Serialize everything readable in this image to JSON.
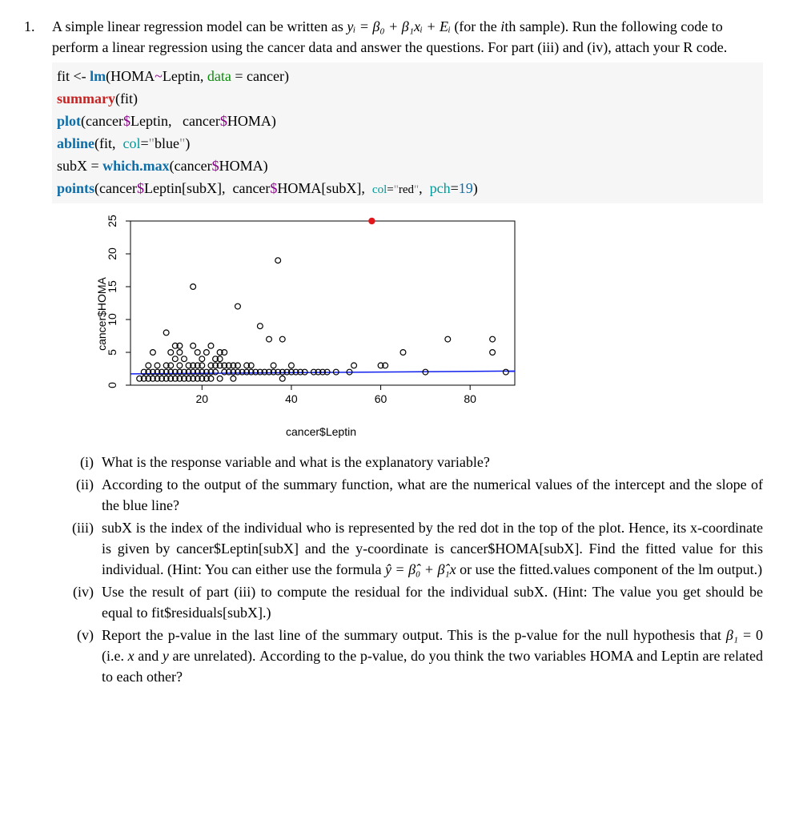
{
  "numLabel": "1.",
  "intro": "A simple linear regression model can be written as ",
  "equation": "yᵢ = β₀ + β₁xᵢ + Eᵢ",
  "introTail": " (for the ",
  "ith": "i",
  "introTail2": "th sample). Run the following code to perform a linear regression using the cancer data and answer the questions. For part (iii) and (iv), attach your R code.",
  "code": {
    "l1a": "fit <- ",
    "l1b": "lm",
    "l1c": "(HOMA",
    "l1d": "~",
    "l1e": "Leptin, ",
    "l1f": "data",
    "l1g": " = cancer)",
    "l2a": "summary",
    "l2b": "(fit)",
    "l3a": "plot",
    "l3b": "(cancer",
    "l3c": "$",
    "l3d": "Leptin,   cancer",
    "l3e": "$",
    "l3f": "HOMA)",
    "l4a": "abline",
    "l4b": "(fit,  ",
    "l4c": "col",
    "l4d": "=",
    "l4e": "\"",
    "l4f": "blue",
    "l4g": "\"",
    "l4h": ")",
    "l5a": "subX = ",
    "l5b": "which.max",
    "l5c": "(cancer",
    "l5d": "$",
    "l5e": "HOMA)",
    "l6a": "points",
    "l6b": "(cancer",
    "l6c": "$",
    "l6d": "Leptin[subX],  cancer",
    "l6e": "$",
    "l6f": "HOMA[subX],  ",
    "l6g": "col",
    "l6h": "=",
    "l6i": "\"",
    "l6j": "red",
    "l6k": "\"",
    "l6l": ",  ",
    "l6m": "pch",
    "l6n": "=",
    "l6o": "19",
    "l6p": ")"
  },
  "chart_data": {
    "type": "scatter",
    "xlabel": "cancer$Leptin",
    "ylabel": "cancer$HOMA",
    "xlim": [
      4,
      90
    ],
    "ylim": [
      0,
      25
    ],
    "xticks": [
      20,
      40,
      60,
      80
    ],
    "yticks": [
      0,
      5,
      10,
      15,
      20,
      25
    ],
    "abline": {
      "intercept": 1.7,
      "slope": 0.005,
      "color": "blue"
    },
    "highlight": {
      "x": 58,
      "y": 25,
      "color": "red"
    },
    "series": [
      {
        "name": "points",
        "marker": "open-circle",
        "data": [
          [
            6,
            1
          ],
          [
            7,
            2
          ],
          [
            7,
            1
          ],
          [
            8,
            1
          ],
          [
            8,
            2
          ],
          [
            8,
            3
          ],
          [
            9,
            1
          ],
          [
            9,
            2
          ],
          [
            9,
            5
          ],
          [
            10,
            2
          ],
          [
            10,
            1
          ],
          [
            10,
            3
          ],
          [
            11,
            1
          ],
          [
            11,
            2
          ],
          [
            12,
            1
          ],
          [
            12,
            2
          ],
          [
            12,
            3
          ],
          [
            12,
            8
          ],
          [
            13,
            1
          ],
          [
            13,
            2
          ],
          [
            13,
            3
          ],
          [
            13,
            5
          ],
          [
            14,
            1
          ],
          [
            14,
            2
          ],
          [
            14,
            4
          ],
          [
            14,
            6
          ],
          [
            15,
            1
          ],
          [
            15,
            2
          ],
          [
            15,
            3
          ],
          [
            15,
            5
          ],
          [
            15,
            6
          ],
          [
            16,
            1
          ],
          [
            16,
            2
          ],
          [
            16,
            4
          ],
          [
            17,
            1
          ],
          [
            17,
            2
          ],
          [
            17,
            3
          ],
          [
            18,
            1
          ],
          [
            18,
            2
          ],
          [
            18,
            3
          ],
          [
            18,
            6
          ],
          [
            18,
            15
          ],
          [
            19,
            1
          ],
          [
            19,
            2
          ],
          [
            19,
            3
          ],
          [
            19,
            5
          ],
          [
            20,
            1
          ],
          [
            20,
            2
          ],
          [
            20,
            3
          ],
          [
            20,
            4
          ],
          [
            21,
            1
          ],
          [
            21,
            2
          ],
          [
            21,
            5
          ],
          [
            22,
            1
          ],
          [
            22,
            2
          ],
          [
            22,
            3
          ],
          [
            22,
            6
          ],
          [
            23,
            2
          ],
          [
            23,
            3
          ],
          [
            23,
            4
          ],
          [
            24,
            1
          ],
          [
            24,
            3
          ],
          [
            24,
            4
          ],
          [
            24,
            5
          ],
          [
            25,
            2
          ],
          [
            25,
            3
          ],
          [
            25,
            5
          ],
          [
            26,
            2
          ],
          [
            26,
            3
          ],
          [
            27,
            1
          ],
          [
            27,
            2
          ],
          [
            27,
            3
          ],
          [
            28,
            2
          ],
          [
            28,
            3
          ],
          [
            28,
            12
          ],
          [
            29,
            2
          ],
          [
            30,
            2
          ],
          [
            30,
            3
          ],
          [
            31,
            2
          ],
          [
            31,
            3
          ],
          [
            32,
            2
          ],
          [
            33,
            2
          ],
          [
            33,
            9
          ],
          [
            34,
            2
          ],
          [
            35,
            2
          ],
          [
            35,
            7
          ],
          [
            36,
            2
          ],
          [
            36,
            3
          ],
          [
            37,
            2
          ],
          [
            37,
            19
          ],
          [
            38,
            1
          ],
          [
            38,
            2
          ],
          [
            38,
            7
          ],
          [
            39,
            2
          ],
          [
            40,
            2
          ],
          [
            40,
            3
          ],
          [
            41,
            2
          ],
          [
            42,
            2
          ],
          [
            43,
            2
          ],
          [
            45,
            2
          ],
          [
            46,
            2
          ],
          [
            47,
            2
          ],
          [
            48,
            2
          ],
          [
            50,
            2
          ],
          [
            53,
            2
          ],
          [
            54,
            3
          ],
          [
            60,
            3
          ],
          [
            61,
            3
          ],
          [
            65,
            5
          ],
          [
            70,
            2
          ],
          [
            75,
            7
          ],
          [
            85,
            5
          ],
          [
            85,
            7
          ],
          [
            88,
            2
          ]
        ]
      }
    ]
  },
  "sub": {
    "i_num": "(i)",
    "i": "What is the response variable and what is the explanatory variable?",
    "ii_num": "(ii)",
    "ii": "According to the output of the summary function, what are the numerical values of the intercept and the slope of the blue line?",
    "iii_num": "(iii)",
    "iii_a": "subX is the index of the individual who is represented by the red dot in the top of the plot. Hence, its x-coordinate is given by cancer$Leptin[subX] and the y-coordinate is cancer$HOMA[subX]. Find the fitted value for this individual. (Hint: You can either use the formula ",
    "iii_eq": "ŷ = β̂₀ + β̂₁x",
    "iii_b": " or use the fitted.values component of the lm output.)",
    "iv_num": "(iv)",
    "iv": "Use the result of part (iii) to compute the residual for the individual subX. (Hint: The value you get should be equal to fit$residuals[subX].)",
    "v_num": "(v)",
    "v_a": "Report the p-value in the last line of the summary output. This is the p-value for the null hypothesis that ",
    "v_eqL": "β₁",
    "v_eqM": " = 0 (i.e. ",
    "v_x": "x",
    "v_and": " and ",
    "v_y": "y",
    "v_b": " are unrelated). According to the p-value, do you think the two variables HOMA and Leptin are related to each other?"
  }
}
